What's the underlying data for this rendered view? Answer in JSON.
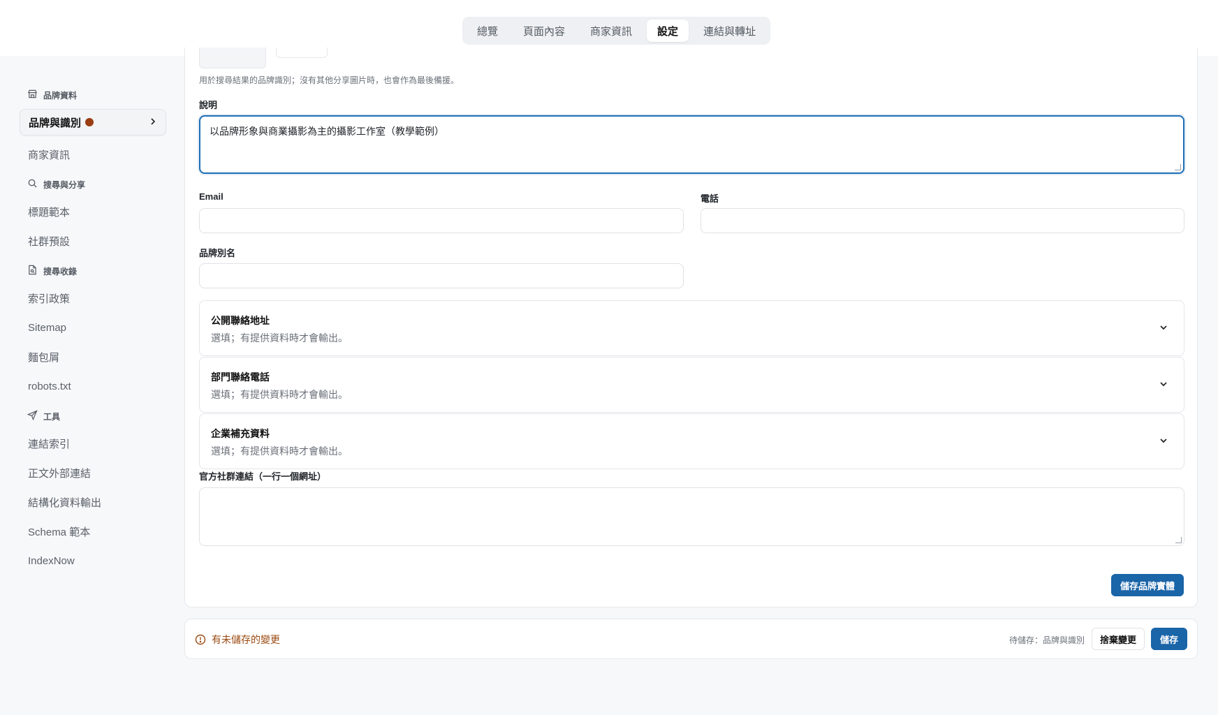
{
  "tabs": [
    {
      "label": "總覽"
    },
    {
      "label": "頁面內容"
    },
    {
      "label": "商家資訊"
    },
    {
      "label": "設定",
      "active": true
    },
    {
      "label": "連結與轉址"
    }
  ],
  "sidebar": {
    "sections": [
      {
        "title": "品牌資料",
        "icon": "store-icon",
        "items": [
          {
            "label": "品牌與識別",
            "active": true,
            "has_changes": true
          },
          {
            "label": "商家資訊"
          }
        ]
      },
      {
        "title": "搜尋與分享",
        "icon": "search-icon",
        "items": [
          {
            "label": "標題範本"
          },
          {
            "label": "社群預設"
          }
        ]
      },
      {
        "title": "搜尋收錄",
        "icon": "file-search-icon",
        "items": [
          {
            "label": "索引政策"
          },
          {
            "label": "Sitemap"
          },
          {
            "label": "麵包屑"
          },
          {
            "label": "robots.txt"
          }
        ]
      },
      {
        "title": "工具",
        "icon": "send-icon",
        "items": [
          {
            "label": "連結索引"
          },
          {
            "label": "正文外部連結"
          },
          {
            "label": "結構化資料輸出"
          },
          {
            "label": "Schema 範本"
          },
          {
            "label": "IndexNow"
          }
        ]
      }
    ]
  },
  "form": {
    "logo_hint": "用於搜尋結果的品牌識別；沒有其他分享圖片時，也會作為最後備援。",
    "description_label": "說明",
    "description_value": "以品牌形象與商業攝影為主的攝影工作室（教學範例）",
    "email_label": "Email",
    "email_value": "",
    "phone_label": "電話",
    "phone_value": "",
    "alias_label": "品牌別名",
    "alias_value": "",
    "accordions": [
      {
        "title": "公開聯絡地址",
        "subtitle": "選填；有提供資料時才會輸出。"
      },
      {
        "title": "部門聯絡電話",
        "subtitle": "選填；有提供資料時才會輸出。"
      },
      {
        "title": "企業補充資料",
        "subtitle": "選填；有提供資料時才會輸出。"
      }
    ],
    "social_label": "官方社群連結（一行一個網址）",
    "social_value": "",
    "save_entity_label": "儲存品牌實體"
  },
  "footer": {
    "unsaved_text": "有未儲存的變更",
    "pending_text": "待儲存：品牌與識別",
    "discard_label": "捨棄變更",
    "save_label": "儲存"
  },
  "colors": {
    "accent": "#1a64a8",
    "warning": "#9a4a10",
    "change_dot": "#9a3d12"
  }
}
